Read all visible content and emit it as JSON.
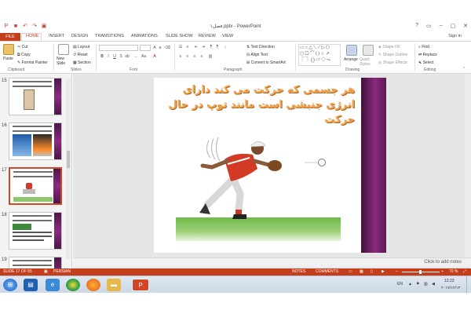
{
  "window": {
    "title": "فصل۱.pptx - PowerPoint",
    "controls": [
      "?",
      "▭",
      "–",
      "▢",
      "✕"
    ],
    "signin": "Sign in"
  },
  "tabs": [
    "FILE",
    "HOME",
    "INSERT",
    "DESIGN",
    "TRANSITIONS",
    "ANIMATIONS",
    "SLIDE SHOW",
    "REVIEW",
    "VIEW"
  ],
  "ribbon": {
    "clipboard": {
      "paste": "Paste",
      "cut": "Cut",
      "copy": "Copy",
      "format_painter": "Format Painter",
      "label": "Clipboard"
    },
    "slides": {
      "new_slide": "New Slide",
      "layout": "Layout",
      "reset": "Reset",
      "section": "Section",
      "label": "Slides"
    },
    "font": {
      "label": "Font"
    },
    "paragraph": {
      "text_direction": "Text Direction",
      "align_text": "Align Text",
      "smartart": "Convert to SmartArt",
      "label": "Paragraph"
    },
    "drawing": {
      "arrange": "Arrange",
      "quick_styles": "Quick Styles",
      "shape_fill": "Shape Fill",
      "shape_outline": "Shape Outline",
      "shape_effects": "Shape Effects",
      "label": "Drawing"
    },
    "editing": {
      "find": "Find",
      "replace": "Replace",
      "select": "Select",
      "label": "Editing"
    }
  },
  "slides_panel": {
    "items": [
      {
        "num": "15"
      },
      {
        "num": "16"
      },
      {
        "num": "17",
        "selected": true
      },
      {
        "num": "18"
      },
      {
        "num": "19"
      }
    ]
  },
  "slide": {
    "title": "هر جسمی که حرکت می کند دارای انرژی جنبشی است مانند توپ در حال حرکت"
  },
  "notes": {
    "placeholder": "Click to add notes"
  },
  "status": {
    "slide_info": "SLIDE 17 OF 55",
    "language": "PERSIAN",
    "notes": "NOTES",
    "comments": "COMMENTS",
    "zoom": "70 %"
  },
  "taskbar": {
    "lang": "EN",
    "time": "12:23",
    "date": "۲۰۱۷/۱۲/۱۳"
  },
  "colors": {
    "accent": "#c43e1c",
    "slide_purple": "#8c2a7e",
    "title_orange": "#f4a44a"
  }
}
